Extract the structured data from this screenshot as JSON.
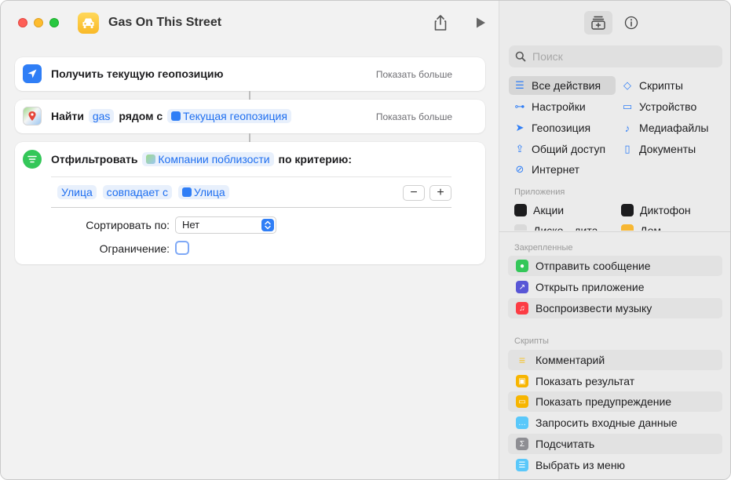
{
  "window": {
    "title": "Gas On This Street"
  },
  "actions": [
    {
      "label": "Получить текущую геопозицию",
      "show_more": "Показать больше"
    },
    {
      "label_prefix": "Найти",
      "search_token": "gas",
      "label_middle": "рядом с",
      "location_token": "Текущая геопозиция",
      "show_more": "Показать больше"
    },
    {
      "label_prefix": "Отфильтровать",
      "input_token": "Компании поблизости",
      "label_suffix": "по критерию:",
      "filter": {
        "field": "Улица",
        "operator": "совпадает с",
        "value": "Улица",
        "minus": "−",
        "plus": "+"
      },
      "sort_label": "Сортировать по:",
      "sort_value": "Нет",
      "limit_label": "Ограничение:",
      "limit_checked": false
    }
  ],
  "library": {
    "search_placeholder": "Поиск",
    "categories_left": [
      "Все действия",
      "Настройки",
      "Геопозиция",
      "Общий доступ",
      "Интернет"
    ],
    "categories_right": [
      "Скрипты",
      "Устройство",
      "Медиафайлы",
      "Документы"
    ],
    "apps_label": "Приложения",
    "apps_left": [
      "Акции",
      "Диско…дита"
    ],
    "apps_right": [
      "Диктофон",
      "Дом"
    ],
    "pinned_label": "Закрепленные",
    "pinned": [
      "Отправить сообщение",
      "Открыть приложение",
      "Воспроизвести музыку"
    ],
    "scripts_label": "Скрипты",
    "scripts": [
      "Комментарий",
      "Показать результат",
      "Показать предупреждение",
      "Запросить входные данные",
      "Подсчитать",
      "Выбрать из меню"
    ]
  },
  "colors": {
    "accent": "#2f7ef6",
    "token_bg": "#e8f0fc"
  }
}
